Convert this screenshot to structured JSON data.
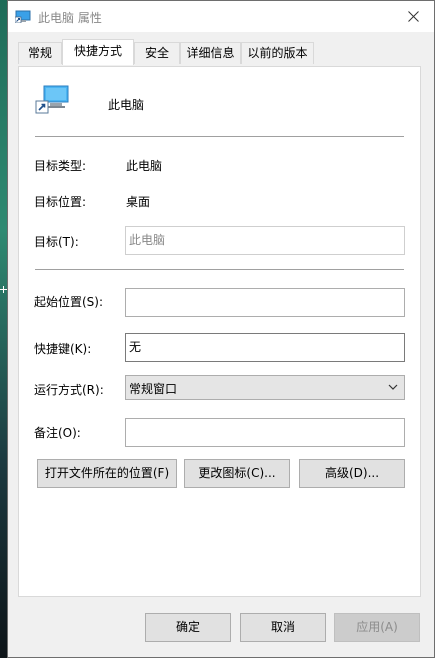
{
  "window": {
    "title": "此电脑 属性",
    "close_icon": "close-icon"
  },
  "tabs": [
    {
      "label": "常规",
      "active": false
    },
    {
      "label": "快捷方式",
      "active": true
    },
    {
      "label": "安全",
      "active": false
    },
    {
      "label": "详细信息",
      "active": false
    },
    {
      "label": "以前的版本",
      "active": false
    }
  ],
  "shortcut": {
    "name": "此电脑",
    "target_type_label": "目标类型:",
    "target_type_value": "此电脑",
    "target_location_label": "目标位置:",
    "target_location_value": "桌面",
    "target_label": "目标(T):",
    "target_value": "此电脑",
    "start_in_label": "起始位置(S):",
    "start_in_value": "",
    "shortcut_key_label": "快捷键(K):",
    "shortcut_key_value": "无",
    "run_label": "运行方式(R):",
    "run_value": "常规窗口",
    "comment_label": "备注(O):",
    "comment_value": ""
  },
  "actions": {
    "open_location": "打开文件所在的位置(F)",
    "change_icon": "更改图标(C)...",
    "advanced": "高级(D)..."
  },
  "footer": {
    "ok": "确定",
    "cancel": "取消",
    "apply": "应用(A)"
  }
}
